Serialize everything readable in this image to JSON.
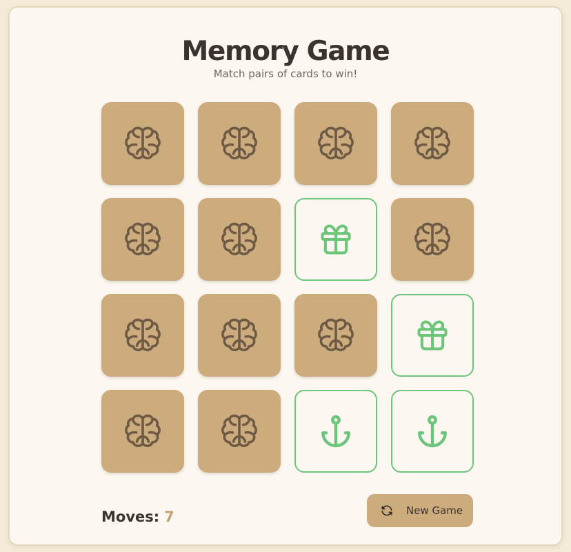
{
  "header": {
    "title": "Memory Game",
    "subtitle": "Match pairs of cards to win!"
  },
  "board": {
    "columns": 4,
    "cards": [
      {
        "state": "hidden",
        "icon": "brain-icon"
      },
      {
        "state": "hidden",
        "icon": "brain-icon"
      },
      {
        "state": "hidden",
        "icon": "brain-icon"
      },
      {
        "state": "hidden",
        "icon": "brain-icon"
      },
      {
        "state": "hidden",
        "icon": "brain-icon"
      },
      {
        "state": "hidden",
        "icon": "brain-icon"
      },
      {
        "state": "matched",
        "icon": "gift-icon"
      },
      {
        "state": "hidden",
        "icon": "brain-icon"
      },
      {
        "state": "hidden",
        "icon": "brain-icon"
      },
      {
        "state": "hidden",
        "icon": "brain-icon"
      },
      {
        "state": "hidden",
        "icon": "brain-icon"
      },
      {
        "state": "matched",
        "icon": "gift-icon"
      },
      {
        "state": "hidden",
        "icon": "brain-icon"
      },
      {
        "state": "hidden",
        "icon": "brain-icon"
      },
      {
        "state": "matched",
        "icon": "anchor-icon"
      },
      {
        "state": "matched",
        "icon": "anchor-icon"
      }
    ]
  },
  "footer": {
    "moves_label": "Moves:",
    "moves_value": "7",
    "new_game_label": "New Game",
    "new_game_icon": "refresh-icon"
  },
  "colors": {
    "page_background": "#f4ecd8",
    "panel_background": "#fcf8f1",
    "card_back": "#ccab7d",
    "card_back_icon": "#6e5a44",
    "matched_accent": "#6cc57a",
    "moves_accent": "#c5a274",
    "text": "#3a3330"
  }
}
